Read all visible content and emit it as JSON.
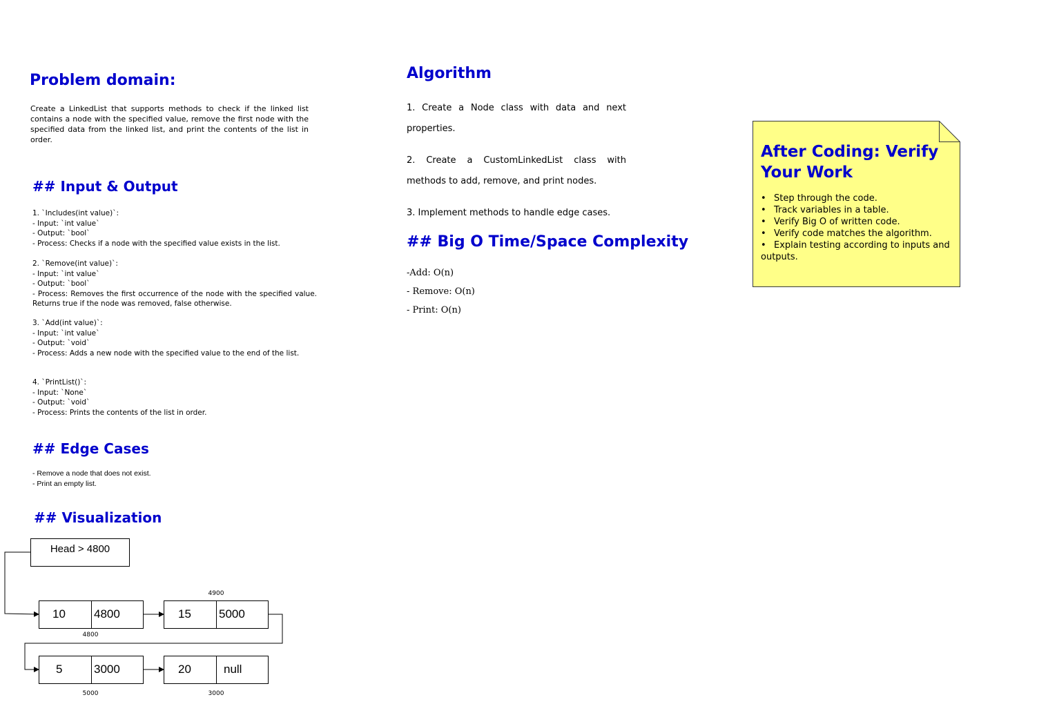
{
  "problem": {
    "title": "Problem domain:",
    "text": "Create a LinkedList that supports methods to check if the linked list contains a node with the specified value, remove the first node with the specified data from the linked list, and print the contents of the list in order."
  },
  "io": {
    "title": "## Input & Output",
    "items": [
      {
        "lines": [
          "1. `Includes(int value)`:",
          "- Input: `int value`",
          "- Output: `bool`",
          "- Process: Checks if a node with the specified value exists in the list."
        ]
      },
      {
        "lines": [
          "2. `Remove(int value)`:",
          "- Input: `int value`",
          "- Output: `bool`"
        ],
        "process": "- Process: Removes the first occurrence of the node with the specified value. Returns true if the node was removed, false otherwise."
      },
      {
        "lines": [
          "3. `Add(int value)`:",
          "- Input: `int value`",
          "- Output: `void`"
        ],
        "process": "- Process: Adds a new node with the specified value to the end of the list."
      },
      {
        "lines": [
          "4. `PrintList()`:",
          "- Input: `None`",
          "- Output: `void`",
          "- Process: Prints the contents of the list in order."
        ]
      }
    ]
  },
  "edge": {
    "title": "## Edge Cases",
    "lines": [
      "- Remove a node that does not exist.",
      "- Print an empty list."
    ]
  },
  "viz": {
    "title": "## Visualization",
    "head_label": "Head > 4800",
    "nodes": [
      {
        "value": "10",
        "next": "4800",
        "addr": "4800"
      },
      {
        "value": "15",
        "next": "5000",
        "addr": "4900"
      },
      {
        "value": "5",
        "next": "3000",
        "addr": "5000"
      },
      {
        "value": "20",
        "next": "null",
        "addr": "3000"
      }
    ]
  },
  "algorithm": {
    "title": "Algorithm",
    "steps": [
      {
        "line1": "1. Create a Node class with data and next",
        "line2": "properties."
      },
      {
        "line1": "2. Create a CustomLinkedList class with",
        "line2": "methods to add, remove, and print nodes."
      },
      {
        "line1": "3. Implement methods to handle edge cases.",
        "line2": ""
      }
    ]
  },
  "bigo": {
    "title": "## Big O Time/Space Complexity",
    "items": [
      "-Add: O(n)",
      "- Remove: O(n)",
      "- Print: O(n)"
    ]
  },
  "note": {
    "title": "After Coding: Verify Your Work",
    "bullet": "•",
    "items": [
      "Step through the code.",
      "Track variables in a table.",
      "Verify Big O of written code.",
      "Verify code matches the algorithm.",
      "Explain testing according to inputs and outputs."
    ],
    "fill": "#ffff88",
    "border": "#36393d"
  },
  "colors": {
    "heading": "#0000cc"
  }
}
